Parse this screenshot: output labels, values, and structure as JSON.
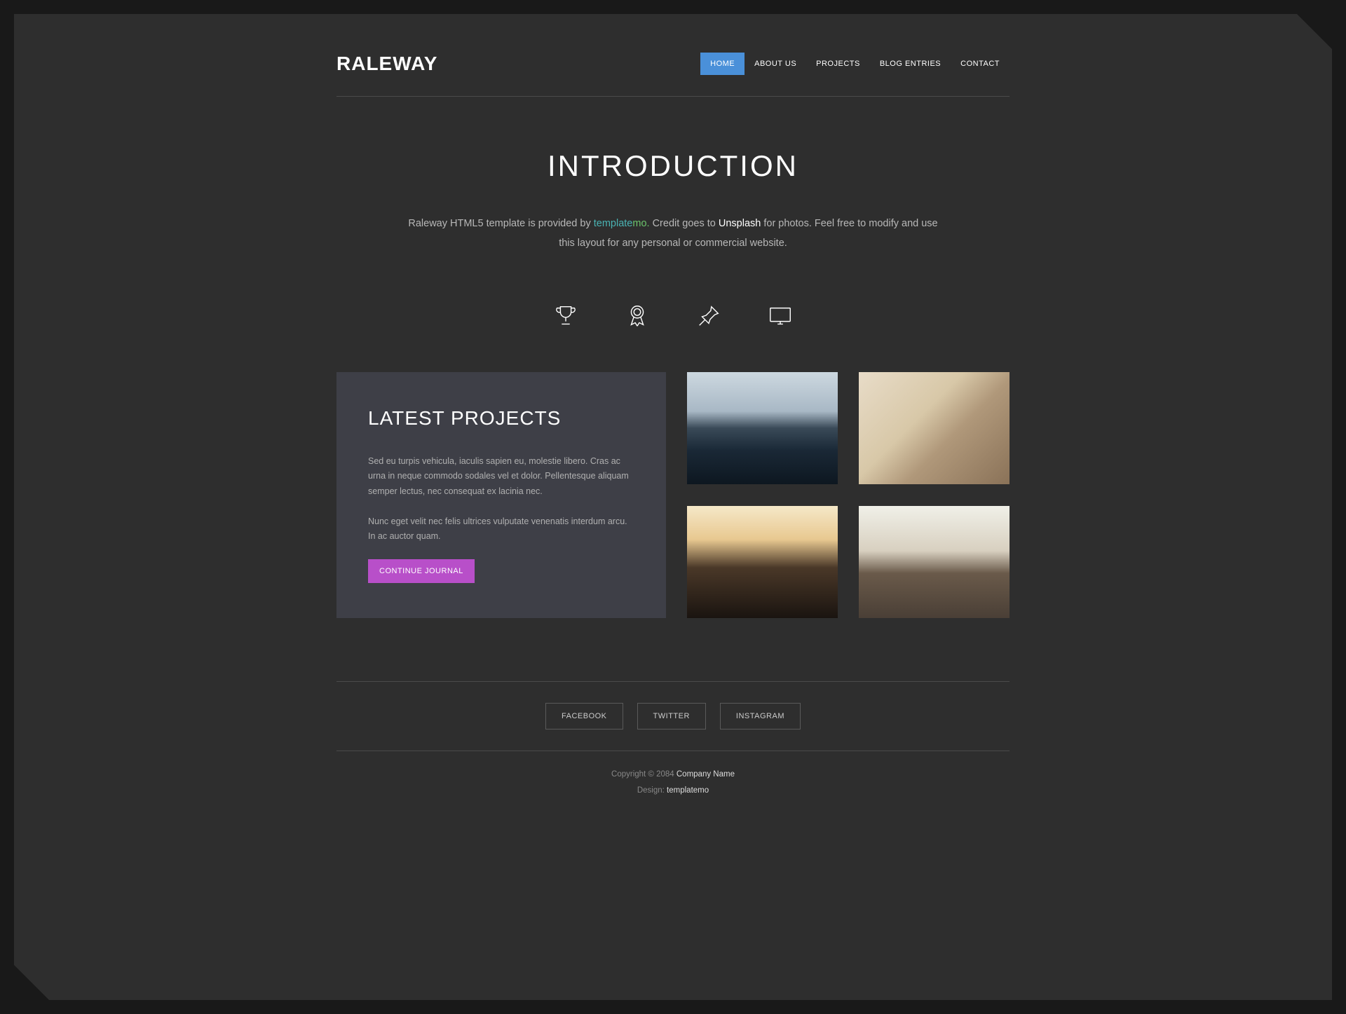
{
  "header": {
    "logo": "RALEWAY",
    "nav": [
      {
        "label": "HOME",
        "active": true
      },
      {
        "label": "ABOUT US",
        "active": false
      },
      {
        "label": "PROJECTS",
        "active": false
      },
      {
        "label": "BLOG ENTRIES",
        "active": false
      },
      {
        "label": "CONTACT",
        "active": false
      }
    ]
  },
  "intro": {
    "title": "INTRODUCTION",
    "text_before": "Raleway HTML5 template is provided by ",
    "template_label": "template",
    "mo_label": "mo",
    "dot": ".",
    "text_mid": " Credit goes to ",
    "unsplash_label": "Unsplash",
    "text_after": " for photos. Feel free to modify and use this layout for any personal or commercial website."
  },
  "icons": [
    "trophy-icon",
    "badge-icon",
    "pin-icon",
    "monitor-icon"
  ],
  "projects": {
    "title": "LATEST PROJECTS",
    "para1": "Sed eu turpis vehicula, iaculis sapien eu, molestie libero. Cras ac urna in neque commodo sodales vel et dolor. Pellentesque aliquam semper lectus, nec consequat ex lacinia nec.",
    "para2": "Nunc eget velit nec felis ultrices vulputate venenatis interdum arcu. In ac auctor quam.",
    "button": "CONTINUE JOURNAL"
  },
  "social": [
    "FACEBOOK",
    "TWITTER",
    "INSTAGRAM"
  ],
  "footer": {
    "copyright_pre": "Copyright © 2084 ",
    "company": "Company Name",
    "design_pre": "Design: ",
    "design_link": "templatemo"
  }
}
